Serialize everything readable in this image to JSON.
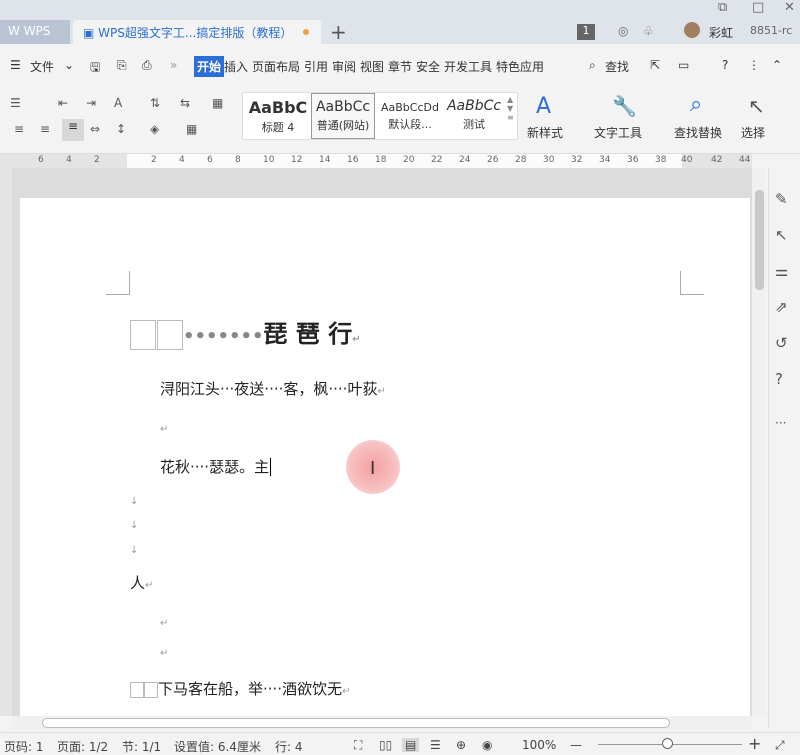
{
  "tabs": {
    "home": "WPS",
    "doc": "WPS超强文字工...搞定排版（教程）",
    "new": "+"
  },
  "titlebar": {
    "badge": "1",
    "user": "彩虹",
    "uid": "8851-rc"
  },
  "menu": {
    "file": "文件",
    "items": [
      "开始",
      "插入",
      "页面布局",
      "引用",
      "审阅",
      "视图",
      "章节",
      "安全",
      "开发工具",
      "特色应用"
    ],
    "search": "查找"
  },
  "styles": [
    {
      "preview": "AaBbC",
      "label": "标题 4"
    },
    {
      "preview": "AaBbCc",
      "label": "普通(网站)"
    },
    {
      "preview": "AaBbCcDd",
      "label": "默认段..."
    },
    {
      "preview": "AaBbCc",
      "label": "测试"
    }
  ],
  "ribbon": {
    "new_style": "新样式",
    "text_tools": "文字工具",
    "find_replace": "查找替换",
    "select": "选择"
  },
  "ruler": [
    "6",
    "4",
    "2",
    "2",
    "4",
    "6",
    "8",
    "10",
    "12",
    "14",
    "16",
    "18",
    "20",
    "22",
    "24",
    "26",
    "28",
    "30",
    "32",
    "34",
    "36",
    "38",
    "40",
    "42",
    "44"
  ],
  "doc": {
    "title": "琵 琶 行",
    "title_dots": "•••••••",
    "line1": "浔阳江头···夜送····客，枫····叶荻",
    "line3": "花秋····瑟瑟。主",
    "line_person": "人",
    "line_last": "下马客在船，举····酒欲饮无",
    "para_mark": "↵",
    "down_mark": "↓"
  },
  "status": {
    "page_code": "页码: 1",
    "page": "页面: 1/2",
    "section": "节: 1/1",
    "setting": "设置值: 6.4厘米",
    "row": "行: 4",
    "zoom": "100%"
  },
  "colors": {
    "accent": "#2b6fd6",
    "tab_bar": "#dfe3ea",
    "page": "#ffffff",
    "canvas": "#dcdcdc"
  }
}
